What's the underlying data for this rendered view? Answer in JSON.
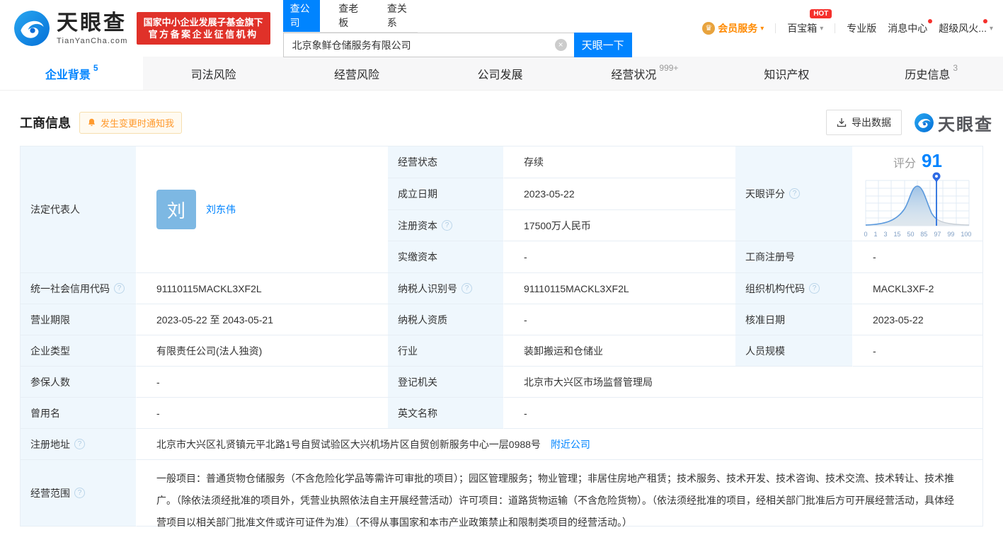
{
  "colors": {
    "accent": "#0084ff",
    "brand_red": "#e03129",
    "orange": "#ff8a00",
    "alert_red": "#f5302c"
  },
  "icons": {
    "clear": "×",
    "caret": "▾",
    "crown": "♛",
    "help": "?"
  },
  "header": {
    "logo_title": "天眼查",
    "logo_domain": "TianYanCha.com",
    "badge_line1": "国家中小企业发展子基金旗下",
    "badge_line2": "官方备案企业征信机构",
    "search_tabs": [
      {
        "label": "查公司"
      },
      {
        "label": "查老板"
      },
      {
        "label": "查关系"
      }
    ],
    "search_value": "北京象鲜仓储服务有限公司",
    "search_button": "天眼一下",
    "nav": {
      "vip": "会员服务",
      "toolbox": "百宝箱",
      "hot": "HOT",
      "pro": "专业版",
      "messages": "消息中心",
      "superfire": "超级风火..."
    }
  },
  "tabs": [
    {
      "label": "企业背景",
      "count": "5"
    },
    {
      "label": "司法风险",
      "count": ""
    },
    {
      "label": "经营风险",
      "count": ""
    },
    {
      "label": "公司发展",
      "count": ""
    },
    {
      "label": "经营状况",
      "count": "999+"
    },
    {
      "label": "知识产权",
      "count": ""
    },
    {
      "label": "历史信息",
      "count": "3"
    }
  ],
  "section": {
    "title": "工商信息",
    "notify_button": "发生变更时通知我",
    "export_button": "导出数据",
    "watermark": "天眼查"
  },
  "score": {
    "prefix": "评分",
    "value": "91",
    "ticks": [
      "0",
      "1",
      "3",
      "15",
      "50",
      "85",
      "97",
      "99",
      "100"
    ]
  },
  "fields": {
    "legal_rep": {
      "label": "法定代表人",
      "avatar": "刘",
      "value": "刘东伟"
    },
    "status": {
      "label": "经营状态",
      "value": "存续"
    },
    "est_date": {
      "label": "成立日期",
      "value": "2023-05-22"
    },
    "reg_capital": {
      "label": "注册资本",
      "value": "17500万人民币"
    },
    "paid_capital": {
      "label": "实缴资本",
      "value": "-"
    },
    "score_label": {
      "label": "天眼评分"
    },
    "reg_number": {
      "label": "工商注册号",
      "value": "-"
    },
    "credit_code": {
      "label": "统一社会信用代码",
      "value": "91110115MACKL3XF2L"
    },
    "taxpayer_id": {
      "label": "纳税人识别号",
      "value": "91110115MACKL3XF2L"
    },
    "org_code": {
      "label": "组织机构代码",
      "value": "MACKL3XF-2"
    },
    "business_term": {
      "label": "营业期限",
      "value": "2023-05-22 至 2043-05-21"
    },
    "taxpayer_quality": {
      "label": "纳税人资质",
      "value": "-"
    },
    "approval_date": {
      "label": "核准日期",
      "value": "2023-05-22"
    },
    "company_type": {
      "label": "企业类型",
      "value": "有限责任公司(法人独资)"
    },
    "industry": {
      "label": "行业",
      "value": "装卸搬运和仓储业"
    },
    "staff_size": {
      "label": "人员规模",
      "value": "-"
    },
    "insured_count": {
      "label": "参保人数",
      "value": "-"
    },
    "registry": {
      "label": "登记机关",
      "value": "北京市大兴区市场监督管理局"
    },
    "former_name": {
      "label": "曾用名",
      "value": "-"
    },
    "english_name": {
      "label": "英文名称",
      "value": "-"
    },
    "address": {
      "label": "注册地址",
      "value": "北京市大兴区礼贤镇元平北路1号自贸试验区大兴机场片区自贸创新服务中心一层0988号",
      "nearby": "附近公司"
    },
    "business_scope": {
      "label": "经营范围",
      "value": "一般项目：普通货物仓储服务（不含危险化学品等需许可审批的项目）；园区管理服务；物业管理；非居住房地产租赁；技术服务、技术开发、技术咨询、技术交流、技术转让、技术推广。（除依法须经批准的项目外，凭营业执照依法自主开展经营活动）许可项目：道路货物运输（不含危险货物）。（依法须经批准的项目，经相关部门批准后方可开展经营活动，具体经营项目以相关部门批准文件或许可证件为准）（不得从事国家和本市产业政策禁止和限制类项目的经营活动。）"
    }
  }
}
